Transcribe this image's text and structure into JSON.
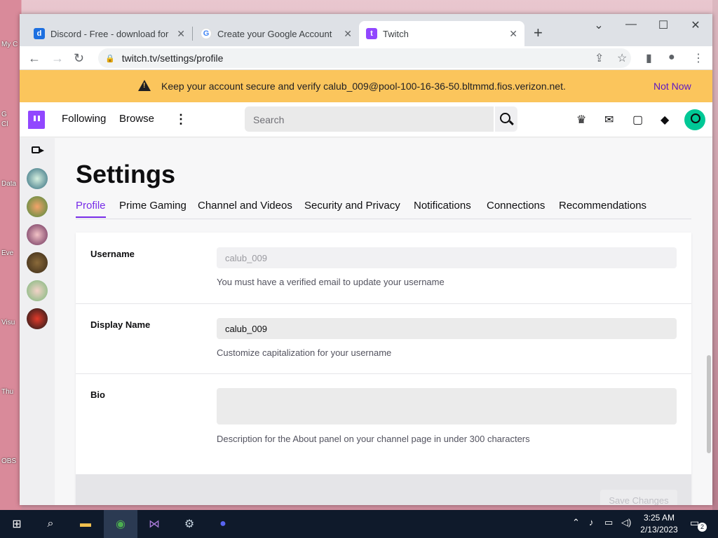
{
  "desktop": {
    "icon_labels": [
      "My C",
      "G",
      "Cl",
      "Data",
      "Eve",
      "Visu",
      "Thu",
      "OBS"
    ]
  },
  "browser": {
    "tabs": [
      {
        "label": "Discord - Free - download for Windows",
        "icon": "discord-icon",
        "close": "✕"
      },
      {
        "label": "Create your Google Account",
        "icon": "google-icon",
        "close": "✕"
      },
      {
        "label": "Twitch",
        "icon": "twitch-icon",
        "close": "✕"
      }
    ],
    "new_tab": "+",
    "url": "twitch.tv/settings/profile"
  },
  "banner": {
    "message": "Keep your account secure and verify calub_009@pool-100-16-36-50.bltmmd.fios.verizon.net.",
    "dismiss": "Not Now"
  },
  "topnav": {
    "following": "Following",
    "browse": "Browse",
    "more": "⋮",
    "search_placeholder": "Search"
  },
  "settings": {
    "title": "Settings",
    "tabs": [
      "Profile",
      "Prime Gaming",
      "Channel and Videos",
      "Security and Privacy",
      "Notifications",
      "Connections",
      "Recommendations"
    ],
    "active_tab": "Profile",
    "username": {
      "label": "Username",
      "value": "calub_009",
      "hint": "You must have a verified email to update your username"
    },
    "display_name": {
      "label": "Display Name",
      "value": "calub_009",
      "hint": "Customize capitalization for your username"
    },
    "bio": {
      "label": "Bio",
      "value": "",
      "hint": "Description for the About panel on your channel page in under 300 characters"
    },
    "save_label": "Save Changes"
  },
  "taskbar": {
    "time": "3:25 AM",
    "date": "2/13/2023",
    "notification_count": "2"
  },
  "colors": {
    "twitch_purple": "#9147ff",
    "banner": "#fbc55c",
    "active_tab": "#772ce8"
  }
}
